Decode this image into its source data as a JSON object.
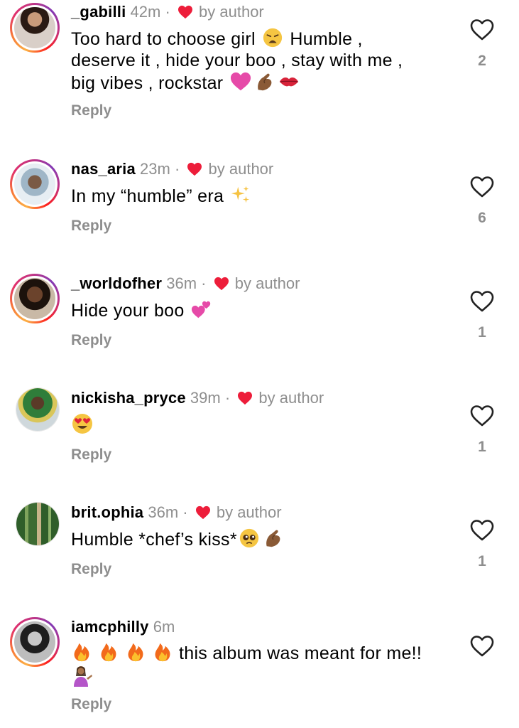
{
  "reply_label": "Reply",
  "by_author_label": "by author",
  "colors": {
    "heart_red": "#ed1d3a",
    "muted": "#8e8e8e",
    "ring_start": "#fcaf45",
    "ring_end": "#833ab4"
  },
  "comments": [
    {
      "username": "_gabilli",
      "time": "42m",
      "separator": "·",
      "liked_by_author": true,
      "text_parts": [
        "Too hard to choose girl",
        "Humble ,",
        "deserve it , hide your boo , stay with me ,",
        "big vibes , rockstar"
      ],
      "emojis": [
        "weary-face",
        "pink-heart",
        "pinching-hand",
        "kiss-mark"
      ],
      "like_count": "2"
    },
    {
      "username": "nas_aria",
      "time": "23m",
      "separator": "·",
      "liked_by_author": true,
      "text_parts": [
        "In my “humble” era"
      ],
      "emojis": [
        "sparkles"
      ],
      "like_count": "6"
    },
    {
      "username": "_worldofher",
      "time": "36m",
      "separator": "·",
      "liked_by_author": true,
      "text_parts": [
        "Hide your boo"
      ],
      "emojis": [
        "two-hearts"
      ],
      "like_count": "1"
    },
    {
      "username": "nickisha_pryce",
      "time": "39m",
      "separator": "·",
      "liked_by_author": true,
      "text_parts": [],
      "emojis": [
        "heart-eyes"
      ],
      "like_count": "1"
    },
    {
      "username": "brit.ophia",
      "time": "36m",
      "separator": "·",
      "liked_by_author": true,
      "text_parts": [
        "Humble *chef’s kiss*"
      ],
      "emojis": [
        "pleading-face",
        "pinching-hand"
      ],
      "like_count": "1"
    },
    {
      "username": "iamcphilly",
      "time": "6m",
      "separator": "",
      "liked_by_author": false,
      "text_parts": [
        "this album was meant for me!!"
      ],
      "emojis": [
        "fire",
        "fire",
        "fire",
        "fire",
        "person-tipping-hand"
      ],
      "like_count": ""
    }
  ]
}
